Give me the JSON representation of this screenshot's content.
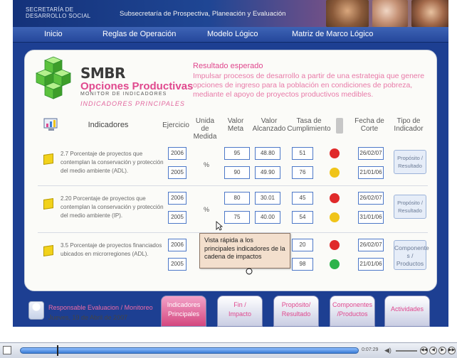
{
  "header": {
    "org_line1": "SECRETARÍA DE",
    "org_line2": "DESARROLLO SOCIAL",
    "subsecretaria": "Subsecretaría de Prospectiva, Planeación y Evaluación"
  },
  "nav": [
    "Inicio",
    "Reglas de Operación",
    "Modelo Lógico",
    "Matriz de Marco Lógico"
  ],
  "logo": {
    "smbr": "SMBR",
    "opciones": "Opciones Productivas",
    "monitor": "MONITOR DE INDICADORES",
    "indicadores_principales": "INDICADORES PRINCIPALES"
  },
  "resultado": {
    "title": "Resultado esperado",
    "text": "Impulsar procesos de desarrollo a partir de una estrategia que genere opciones de ingreso para la población en condiciones de pobreza, mediante el apoyo de proyectos productivos medibles."
  },
  "table": {
    "headers": {
      "indicadores": "Indicadores",
      "ejercicio": "Ejercicio",
      "unidad": "Unida de Medida",
      "valor_meta": "Valor Meta",
      "valor_alcanzado": "Valor Alcanzado",
      "tasa": "Tasa de Cumplimiento",
      "fecha": "Fecha de Corte",
      "tipo": "Tipo de Indicador"
    },
    "rows": [
      {
        "desc": "2.7 Porcentaje de proyectos que contemplan la conservación y protección del medio ambiente (ADL).",
        "unidad": "%",
        "tipo": "Propósito / Resultado",
        "lines": [
          {
            "ejercicio": "2006",
            "meta": "95",
            "alcanzado": "48.80",
            "tasa": "51",
            "status": "#e02a2a",
            "fecha": "26/02/07"
          },
          {
            "ejercicio": "2005",
            "meta": "90",
            "alcanzado": "49.90",
            "tasa": "76",
            "status": "#f0c419",
            "fecha": "21/01/06"
          }
        ]
      },
      {
        "desc": "2.20 Porcentaje de proyectos que contemplan la conservación y protección del medio ambiente (IP).",
        "unidad": "%",
        "tipo": "Propósito / Resultado",
        "lines": [
          {
            "ejercicio": "2006",
            "meta": "80",
            "alcanzado": "30.01",
            "tasa": "45",
            "status": "#e02a2a",
            "fecha": "26/02/07"
          },
          {
            "ejercicio": "2005",
            "meta": "75",
            "alcanzado": "40.00",
            "tasa": "54",
            "status": "#f0c419",
            "fecha": "31/01/06"
          }
        ]
      },
      {
        "desc": "3.5 Porcentaje de proyectos financiados ubicados en microrregiones (ADL).",
        "unidad": "",
        "tipo": "Componente s / Productos",
        "lines": [
          {
            "ejercicio": "2006",
            "meta": "",
            "alcanzado": "",
            "tasa": "20",
            "status": "#e02a2a",
            "fecha": "26/02/07"
          },
          {
            "ejercicio": "2005",
            "meta": "",
            "alcanzado": "",
            "tasa": "98",
            "status": "#2db34a",
            "fecha": "21/01/06"
          }
        ]
      }
    ]
  },
  "tooltip": "Vista rápida a los principales indicadores de la cadena de impactos",
  "footer": {
    "responsable": "Responsable Evaluacion / Monitoreo",
    "date": "Jueves, 19 de Abril de 2007",
    "tabs": [
      [
        "Indicadores",
        "Principales"
      ],
      [
        "Fin /",
        "Impacto"
      ],
      [
        "Propósito/",
        "Resultado"
      ],
      [
        "Componentes",
        "/Productos"
      ],
      [
        "Actividades",
        ""
      ]
    ]
  },
  "player": {
    "time": "0:07:29"
  },
  "colors": {
    "brand_blue": "#1d3f92",
    "accent_pink": "#e0488e",
    "status_red": "#e02a2a",
    "status_yellow": "#f0c419",
    "status_green": "#2db34a"
  }
}
